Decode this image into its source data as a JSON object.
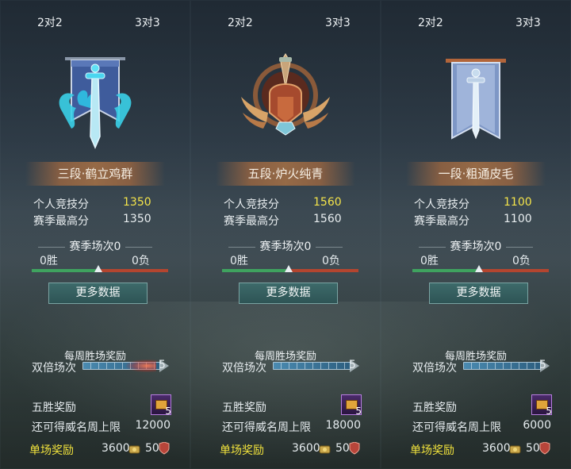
{
  "panels": [
    {
      "tabs": [
        "2对2",
        "3对3"
      ],
      "rank_name": "三段·鹤立鸡群",
      "emblem": "azure-dragon-banner-sword-icon",
      "personal_score_label": "个人竞技分",
      "personal_score": "1350",
      "season_best_label": "赛季最高分",
      "season_best": "1350",
      "season_matches": "赛季场次0",
      "wins": "0胜",
      "losses": "0负",
      "more_button": "更多数据",
      "weekly_title": "每周胜场奖励",
      "double_label": "双倍场次",
      "double_count": "5",
      "five_win_label": "五胜奖励",
      "chest_count": "5",
      "renown_label": "还可得威名周上限",
      "renown_value": "12000",
      "single_reward_label": "单场奖励",
      "coin_value": "3600",
      "honor_value": "50"
    },
    {
      "tabs": [
        "2对2",
        "3对3"
      ],
      "rank_name": "五段·炉火纯青",
      "emblem": "bronze-winged-crest-sword-icon",
      "personal_score_label": "个人竞技分",
      "personal_score": "1560",
      "season_best_label": "赛季最高分",
      "season_best": "1560",
      "season_matches": "赛季场次0",
      "wins": "0胜",
      "losses": "0负",
      "more_button": "更多数据",
      "weekly_title": "每周胜场奖励",
      "double_label": "双倍场次",
      "double_count": "5",
      "five_win_label": "五胜奖励",
      "chest_count": "5",
      "renown_label": "还可得威名周上限",
      "renown_value": "18000",
      "single_reward_label": "单场奖励",
      "coin_value": "3600",
      "honor_value": "50"
    },
    {
      "tabs": [
        "2对2",
        "3对3"
      ],
      "rank_name": "一段·粗通皮毛",
      "emblem": "plain-banner-sword-icon",
      "personal_score_label": "个人竞技分",
      "personal_score": "1100",
      "season_best_label": "赛季最高分",
      "season_best": "1100",
      "season_matches": "赛季场次0",
      "wins": "0胜",
      "losses": "0负",
      "more_button": "更多数据",
      "weekly_title": "每周胜场奖励",
      "double_label": "双倍场次",
      "double_count": "5",
      "five_win_label": "五胜奖励",
      "chest_count": "5",
      "renown_label": "还可得威名周上限",
      "renown_value": "6000",
      "single_reward_label": "单场奖励",
      "coin_value": "3600",
      "honor_value": "50"
    }
  ],
  "win_ratio": 0.5,
  "colors": {
    "score_highlight": "#f4e44a",
    "single_reward": "#f1e23c",
    "win_bar": "#3fa35f",
    "loss_bar": "#b4452f"
  }
}
